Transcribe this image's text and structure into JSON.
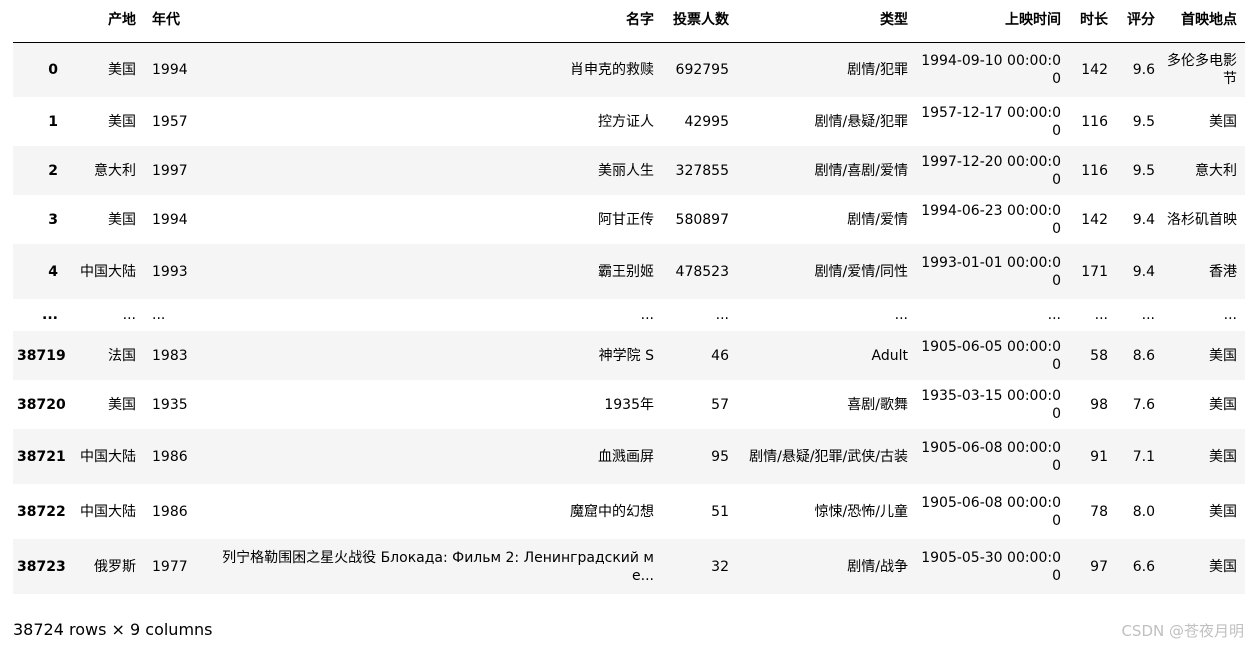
{
  "table": {
    "headers": {
      "index": "",
      "origin": "产地",
      "year": "年代",
      "name": "名字",
      "votes": "投票人数",
      "genre": "类型",
      "release": "上映时间",
      "runtime": "时长",
      "rating": "评分",
      "premiere": "首映地点"
    },
    "rows": [
      {
        "index": "0",
        "origin": "美国",
        "year": "1994",
        "name": "肖申克的救赎",
        "votes": "692795",
        "genre": "剧情/犯罪",
        "release": "1994-09-10 00:00:00",
        "runtime": "142",
        "rating": "9.6",
        "premiere": "多伦多电影节"
      },
      {
        "index": "1",
        "origin": "美国",
        "year": "1957",
        "name": "控方证人",
        "votes": "42995",
        "genre": "剧情/悬疑/犯罪",
        "release": "1957-12-17 00:00:00",
        "runtime": "116",
        "rating": "9.5",
        "premiere": "美国"
      },
      {
        "index": "2",
        "origin": "意大利",
        "year": "1997",
        "name": "美丽人生",
        "votes": "327855",
        "genre": "剧情/喜剧/爱情",
        "release": "1997-12-20 00:00:00",
        "runtime": "116",
        "rating": "9.5",
        "premiere": "意大利"
      },
      {
        "index": "3",
        "origin": "美国",
        "year": "1994",
        "name": "阿甘正传",
        "votes": "580897",
        "genre": "剧情/爱情",
        "release": "1994-06-23 00:00:00",
        "runtime": "142",
        "rating": "9.4",
        "premiere": "洛杉矶首映"
      },
      {
        "index": "4",
        "origin": "中国大陆",
        "year": "1993",
        "name": "霸王别姬",
        "votes": "478523",
        "genre": "剧情/爱情/同性",
        "release": "1993-01-01 00:00:00",
        "runtime": "171",
        "rating": "9.4",
        "premiere": "香港"
      },
      {
        "index": "...",
        "origin": "...",
        "year": "...",
        "name": "...",
        "votes": "...",
        "genre": "...",
        "release": "...",
        "runtime": "...",
        "rating": "...",
        "premiere": "..."
      },
      {
        "index": "38719",
        "origin": "法国",
        "year": "1983",
        "name": "神学院 S",
        "votes": "46",
        "genre": "Adult",
        "release": "1905-06-05 00:00:00",
        "runtime": "58",
        "rating": "8.6",
        "premiere": "美国"
      },
      {
        "index": "38720",
        "origin": "美国",
        "year": "1935",
        "name": "1935年",
        "votes": "57",
        "genre": "喜剧/歌舞",
        "release": "1935-03-15 00:00:00",
        "runtime": "98",
        "rating": "7.6",
        "premiere": "美国"
      },
      {
        "index": "38721",
        "origin": "中国大陆",
        "year": "1986",
        "name": "血溅画屏",
        "votes": "95",
        "genre": "剧情/悬疑/犯罪/武侠/古装",
        "release": "1905-06-08 00:00:00",
        "runtime": "91",
        "rating": "7.1",
        "premiere": "美国"
      },
      {
        "index": "38722",
        "origin": "中国大陆",
        "year": "1986",
        "name": "魔窟中的幻想",
        "votes": "51",
        "genre": "惊悚/恐怖/儿童",
        "release": "1905-06-08 00:00:00",
        "runtime": "78",
        "rating": "8.0",
        "premiere": "美国"
      },
      {
        "index": "38723",
        "origin": "俄罗斯",
        "year": "1977",
        "name": "列宁格勒围困之星火战役 Блокада: Фильм 2: Ленинградский ме...",
        "votes": "32",
        "genre": "剧情/战争",
        "release": "1905-05-30 00:00:00",
        "runtime": "97",
        "rating": "6.6",
        "premiere": "美国"
      }
    ]
  },
  "footer": {
    "shape": "38724 rows × 9 columns"
  },
  "watermark": {
    "text": "CSDN @苍夜月明"
  }
}
